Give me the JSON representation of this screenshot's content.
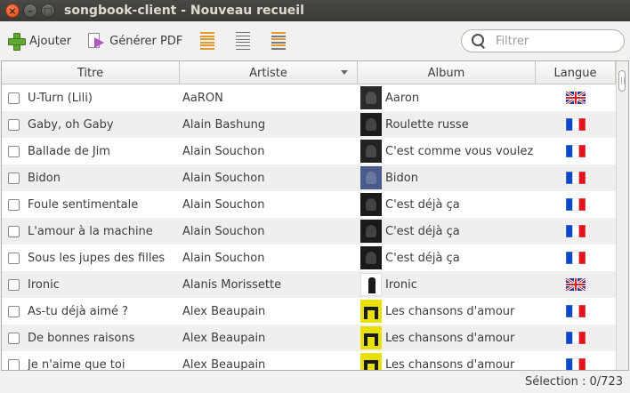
{
  "window": {
    "title": "songbook-client - Nouveau recueil",
    "close_glyph": "×",
    "minimize_glyph": "–",
    "maximize_glyph": "□"
  },
  "toolbar": {
    "add_label": "Ajouter",
    "pdf_label": "Générer PDF",
    "icons": [
      "add-icon",
      "generate-pdf-icon",
      "list-orange-icon",
      "list-gray-icon",
      "list-mixed-icon"
    ],
    "search_placeholder": "Filtrer"
  },
  "table": {
    "columns": [
      "Titre",
      "Artiste",
      "Album",
      "Langue"
    ],
    "sorted_column": "Artiste",
    "rows": [
      {
        "title": "U-Turn (Lili)",
        "artist": "AaRON",
        "album": "Aaron",
        "lang": "en"
      },
      {
        "title": "Gaby, oh Gaby",
        "artist": "Alain Bashung",
        "album": "Roulette russe",
        "lang": "fr"
      },
      {
        "title": "Ballade de Jim",
        "artist": "Alain Souchon",
        "album": "C'est comme vous voulez",
        "lang": "fr"
      },
      {
        "title": "Bidon",
        "artist": "Alain Souchon",
        "album": "Bidon",
        "lang": "fr"
      },
      {
        "title": "Foule sentimentale",
        "artist": "Alain Souchon",
        "album": "C'est déjà ça",
        "lang": "fr"
      },
      {
        "title": "L'amour à la machine",
        "artist": "Alain Souchon",
        "album": "C'est déjà ça",
        "lang": "fr"
      },
      {
        "title": "Sous les jupes des filles",
        "artist": "Alain Souchon",
        "album": "C'est déjà ça",
        "lang": "fr"
      },
      {
        "title": "Ironic",
        "artist": "Alanis Morissette",
        "album": "Ironic",
        "lang": "en"
      },
      {
        "title": "As-tu déjà aimé ?",
        "artist": "Alex Beaupain",
        "album": "Les chansons d'amour",
        "lang": "fr"
      },
      {
        "title": "De bonnes raisons",
        "artist": "Alex Beaupain",
        "album": "Les chansons d'amour",
        "lang": "fr"
      },
      {
        "title": "Je n'aime que toi",
        "artist": "Alex Beaupain",
        "album": "Les chansons d'amour",
        "lang": "fr"
      }
    ]
  },
  "colors": {
    "cover_aaron": "#2a2a2a",
    "cover_bashung": "#1c1c1c",
    "cover_souchon_comme": "#222222",
    "cover_bidon": "#4a5a8a",
    "cover_deja": "#1a1a1a",
    "cover_ironic": "#ffffff",
    "cover_beaupain": "#e8e000"
  },
  "status": {
    "selection": "Sélection : 0/723"
  }
}
